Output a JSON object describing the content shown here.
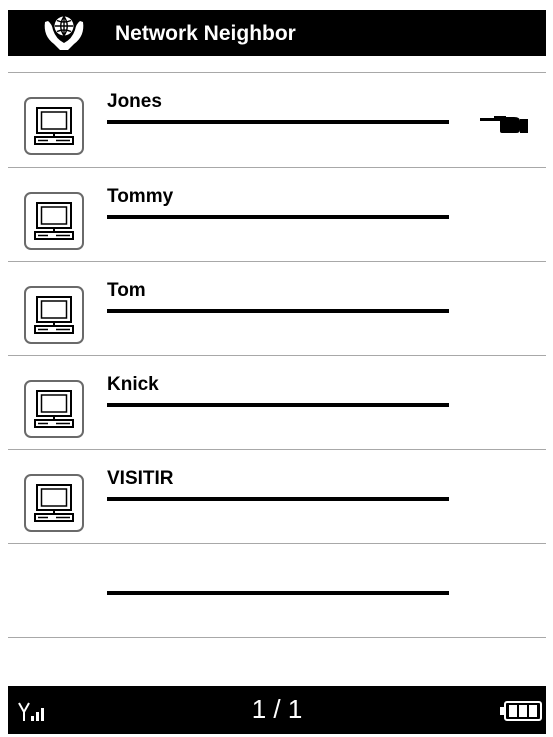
{
  "header": {
    "title": "Network Neighbor",
    "logo_icon": "globe-hands-icon"
  },
  "devices": [
    {
      "name": "Jones",
      "icon": "computer-icon",
      "selected": true
    },
    {
      "name": "Tommy",
      "icon": "computer-icon",
      "selected": false
    },
    {
      "name": "Tom",
      "icon": "computer-icon",
      "selected": false
    },
    {
      "name": "Knick",
      "icon": "computer-icon",
      "selected": false
    },
    {
      "name": "VISITIR",
      "icon": "computer-icon",
      "selected": false
    },
    {
      "name": "",
      "icon": "",
      "selected": false
    }
  ],
  "footer": {
    "page_indicator": "1 / 1",
    "signal_icon": "signal-strength-icon",
    "battery_icon": "battery-icon"
  },
  "colors": {
    "bar": "#000000",
    "divider": "#a8a8a8",
    "background": "#ffffff"
  }
}
